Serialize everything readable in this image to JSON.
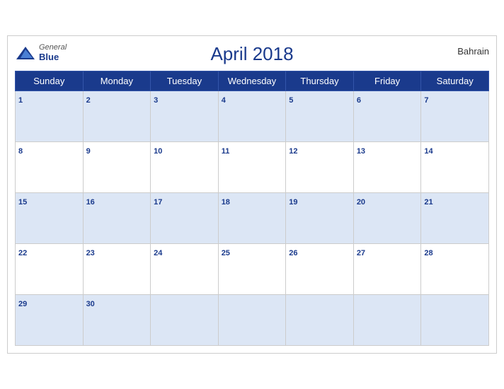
{
  "header": {
    "logo_general": "General",
    "logo_blue": "Blue",
    "title": "April 2018",
    "country": "Bahrain"
  },
  "weekdays": [
    "Sunday",
    "Monday",
    "Tuesday",
    "Wednesday",
    "Thursday",
    "Friday",
    "Saturday"
  ],
  "weeks": [
    [
      {
        "day": "1",
        "empty": false
      },
      {
        "day": "2",
        "empty": false
      },
      {
        "day": "3",
        "empty": false
      },
      {
        "day": "4",
        "empty": false
      },
      {
        "day": "5",
        "empty": false
      },
      {
        "day": "6",
        "empty": false
      },
      {
        "day": "7",
        "empty": false
      }
    ],
    [
      {
        "day": "8",
        "empty": false
      },
      {
        "day": "9",
        "empty": false
      },
      {
        "day": "10",
        "empty": false
      },
      {
        "day": "11",
        "empty": false
      },
      {
        "day": "12",
        "empty": false
      },
      {
        "day": "13",
        "empty": false
      },
      {
        "day": "14",
        "empty": false
      }
    ],
    [
      {
        "day": "15",
        "empty": false
      },
      {
        "day": "16",
        "empty": false
      },
      {
        "day": "17",
        "empty": false
      },
      {
        "day": "18",
        "empty": false
      },
      {
        "day": "19",
        "empty": false
      },
      {
        "day": "20",
        "empty": false
      },
      {
        "day": "21",
        "empty": false
      }
    ],
    [
      {
        "day": "22",
        "empty": false
      },
      {
        "day": "23",
        "empty": false
      },
      {
        "day": "24",
        "empty": false
      },
      {
        "day": "25",
        "empty": false
      },
      {
        "day": "26",
        "empty": false
      },
      {
        "day": "27",
        "empty": false
      },
      {
        "day": "28",
        "empty": false
      }
    ],
    [
      {
        "day": "29",
        "empty": false
      },
      {
        "day": "30",
        "empty": false
      },
      {
        "day": "",
        "empty": true
      },
      {
        "day": "",
        "empty": true
      },
      {
        "day": "",
        "empty": true
      },
      {
        "day": "",
        "empty": true
      },
      {
        "day": "",
        "empty": true
      }
    ]
  ]
}
